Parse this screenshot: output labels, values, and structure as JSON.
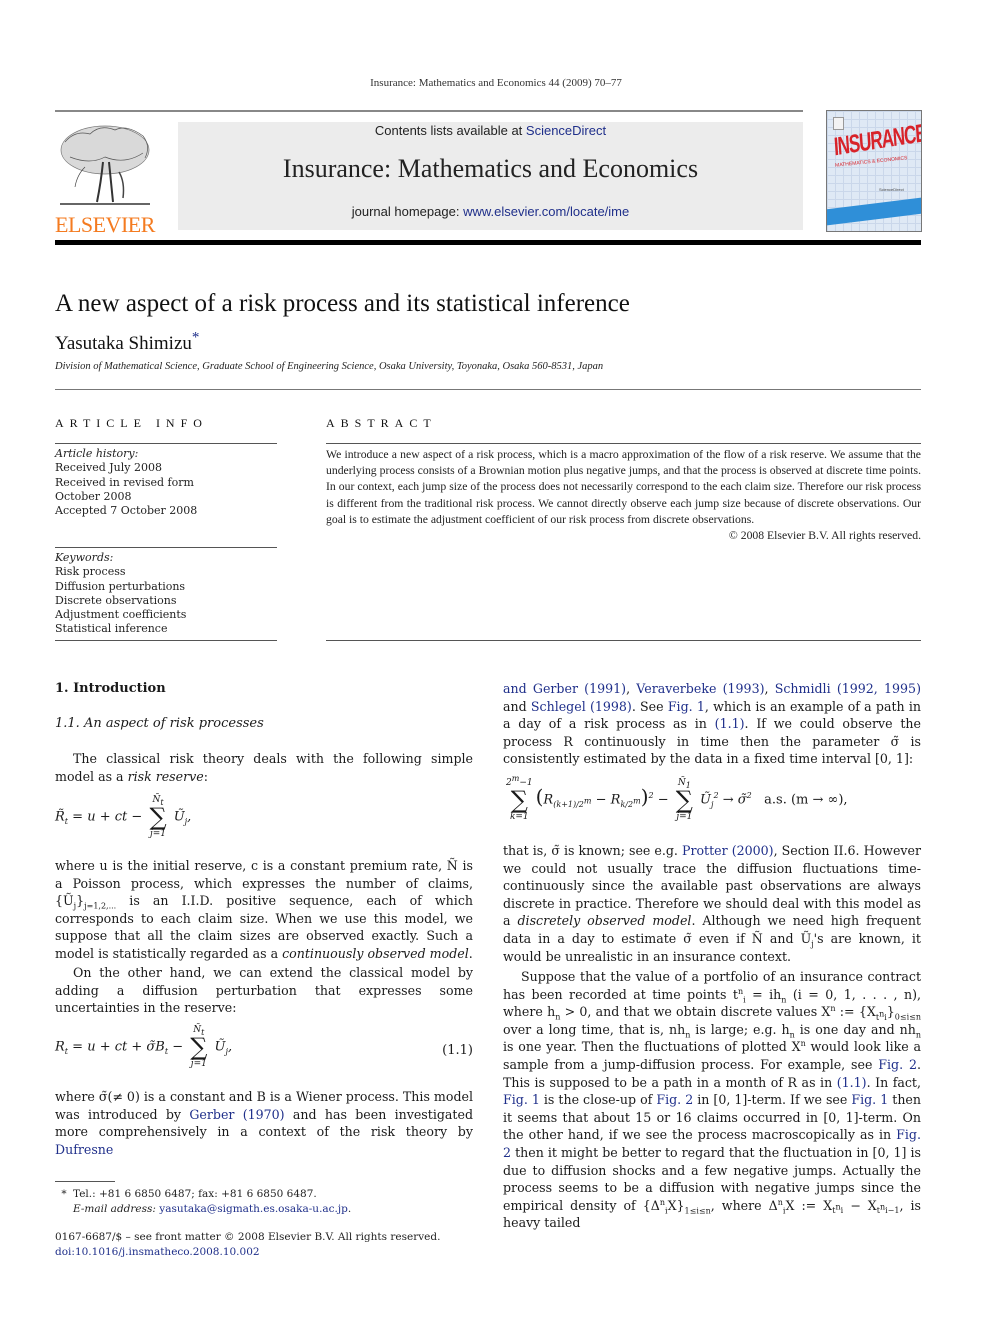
{
  "running_head": "Insurance: Mathematics and Economics 44 (2009) 70–77",
  "publisher": {
    "logo_text": "ELSEVIER",
    "logo_color": "#f47b20"
  },
  "banner": {
    "contents_prefix": "Contents lists available at ",
    "contents_link": "ScienceDirect",
    "journal_title": "Insurance: Mathematics and Economics",
    "homepage_prefix": "journal homepage: ",
    "homepage_link": "www.elsevier.com/locate/ime"
  },
  "cover": {
    "title": "INSURANCE",
    "subtitle": "MATHEMATICS & ECONOMICS"
  },
  "article": {
    "title": "A new aspect of a risk process and its statistical inference",
    "author": "Yasutaka Shimizu",
    "author_marker": "*",
    "affiliation": "Division of Mathematical Science, Graduate School of Engineering Science, Osaka University, Toyonaka, Osaka 560-8531, Japan"
  },
  "article_info": {
    "heading": "ARTICLE INFO",
    "history_label": "Article history:",
    "history": [
      "Received July 2008",
      "Received in revised form",
      "October 2008",
      "Accepted 7 October 2008"
    ],
    "keywords_label": "Keywords:",
    "keywords": [
      "Risk process",
      "Diffusion perturbations",
      "Discrete observations",
      "Adjustment coefficients",
      "Statistical inference"
    ]
  },
  "abstract": {
    "heading": "ABSTRACT",
    "text": "We introduce a new aspect of a risk process, which is a macro approximation of the flow of a risk reserve. We assume that the underlying process consists of a Brownian motion plus negative jumps, and that the process is observed at discrete time points. In our context, each jump size of the process does not necessarily correspond to the each claim size. Therefore our risk process is different from the traditional risk process. We cannot directly observe each jump size because of discrete observations. Our goal is to estimate the adjustment coefficient of our risk process from discrete observations.",
    "copyright": "© 2008 Elsevier B.V. All rights reserved."
  },
  "section": {
    "heading": "1.  Introduction",
    "subheading": "1.1.  An aspect of risk processes",
    "eq_number": "(1.1)",
    "left": {
      "p1a": "The classical risk theory deals with the following simple model as a ",
      "p1_em": "risk reserve",
      "p1b": ":",
      "p2a": "where u is the initial reserve, c is a constant premium rate, Ñ is a Poisson process, which expresses the number of claims, {Ũ",
      "p2b": "}",
      "p2_sub": "j=1,2,...",
      "p2c": " is an I.I.D. positive sequence, each of which corresponds to each claim size. When we use this model, we suppose that all the claim sizes are observed exactly. Such a model is statistically regarded as a ",
      "p2_em": "continuously observed model",
      "p2d": ".",
      "p3": "On the other hand, we can extend the classical model by adding a diffusion perturbation that expresses some uncertainties in the reserve:",
      "p4a": "where σ̃(≠  0) is a constant and B is a Wiener process. This model was introduced by ",
      "p4_link1": "Gerber (1970)",
      "p4b": " and has been investigated more comprehensively in a context of the risk theory by ",
      "p4_link2": "Dufresne"
    },
    "right": {
      "links_line": [
        "and Gerber (1991)",
        "Veraverbeke (1993)",
        "Schmidli (1992, 1995)",
        "Schlegel (1998)",
        "Fig. 1",
        "(1.1)",
        "Protter (2000)",
        "Fig. 2",
        "Fig. 1",
        "Fig. 2",
        "Fig. 1",
        "Fig. 2",
        "(1.1)"
      ],
      "p1a": " which is an example of a path in a day of a risk process as in ",
      "p1b": ". If we could observe the process R continuously in time then the parameter σ̃ is consistently estimated by the data in a fixed time interval [0, 1]:",
      "eq2_suffix": "a.s. (m → ∞),",
      "p2a": "that is, σ̃ is known; see e.g. ",
      "p2b": ", Section II.6. However we could not usually trace the diffusion fluctuations time-continuously since the available past observations are always discrete in practice. Therefore we should deal with this model as a ",
      "p2_em": "discretely observed model",
      "p2c": ". Although we need high frequent data in a day to estimate σ̃ even if Ñ and Ũ",
      "p2d": "'s are known, it would be unrealistic in an insurance context.",
      "p3a": "Suppose that the value of a portfolio of an insurance contract has been recorded at time points t",
      "p3b": " = ih",
      "p3c": " (i = 0, 1, . . . , n), where h",
      "p3d": " > 0, and that we obtain discrete values X",
      "p3e": " := {X",
      "p3f": "}",
      "p3g": " over a long time, that is, nh",
      "p3h": " is large; e.g. h",
      "p3i": " is one day and nh",
      "p3j": " is one year. Then the fluctuations of plotted X",
      "p3k": " would look like a sample from a jump-diffusion process. For example, see ",
      "p3l": ". This is supposed to be a path in a month of R as in ",
      "p3m": ". In fact, ",
      "p3n": " is the close-up of ",
      "p3o": " in [0, 1]-term. If we see ",
      "p3p": " then it seems that about 15 or 16 claims occurred in [0, 1]-term. On the other hand, if we see the process macroscopically as in ",
      "p3q": " then it might be better to regard that the fluctuation in [0, 1] is due to diffusion shocks and a few negative jumps. Actually the process seems to be a diffusion with negative jumps since the empirical density of {Δ",
      "p3r": "X}",
      "p3s": ", where Δ",
      "p3t": "X := X",
      "p3u": " − X",
      "p3v": ", is heavy tailed"
    }
  },
  "footnote": {
    "marker": "*",
    "tel": "Tel.: +81 6 6850 6487; fax: +81 6 6850 6487.",
    "email_label": "E-mail address: ",
    "email": "yasutaka@sigmath.es.osaka-u.ac.jp",
    "front_matter": "0167-6687/$ – see front matter © 2008 Elsevier B.V. All rights reserved.",
    "doi": "doi:10.1016/j.insmatheco.2008.10.002"
  }
}
